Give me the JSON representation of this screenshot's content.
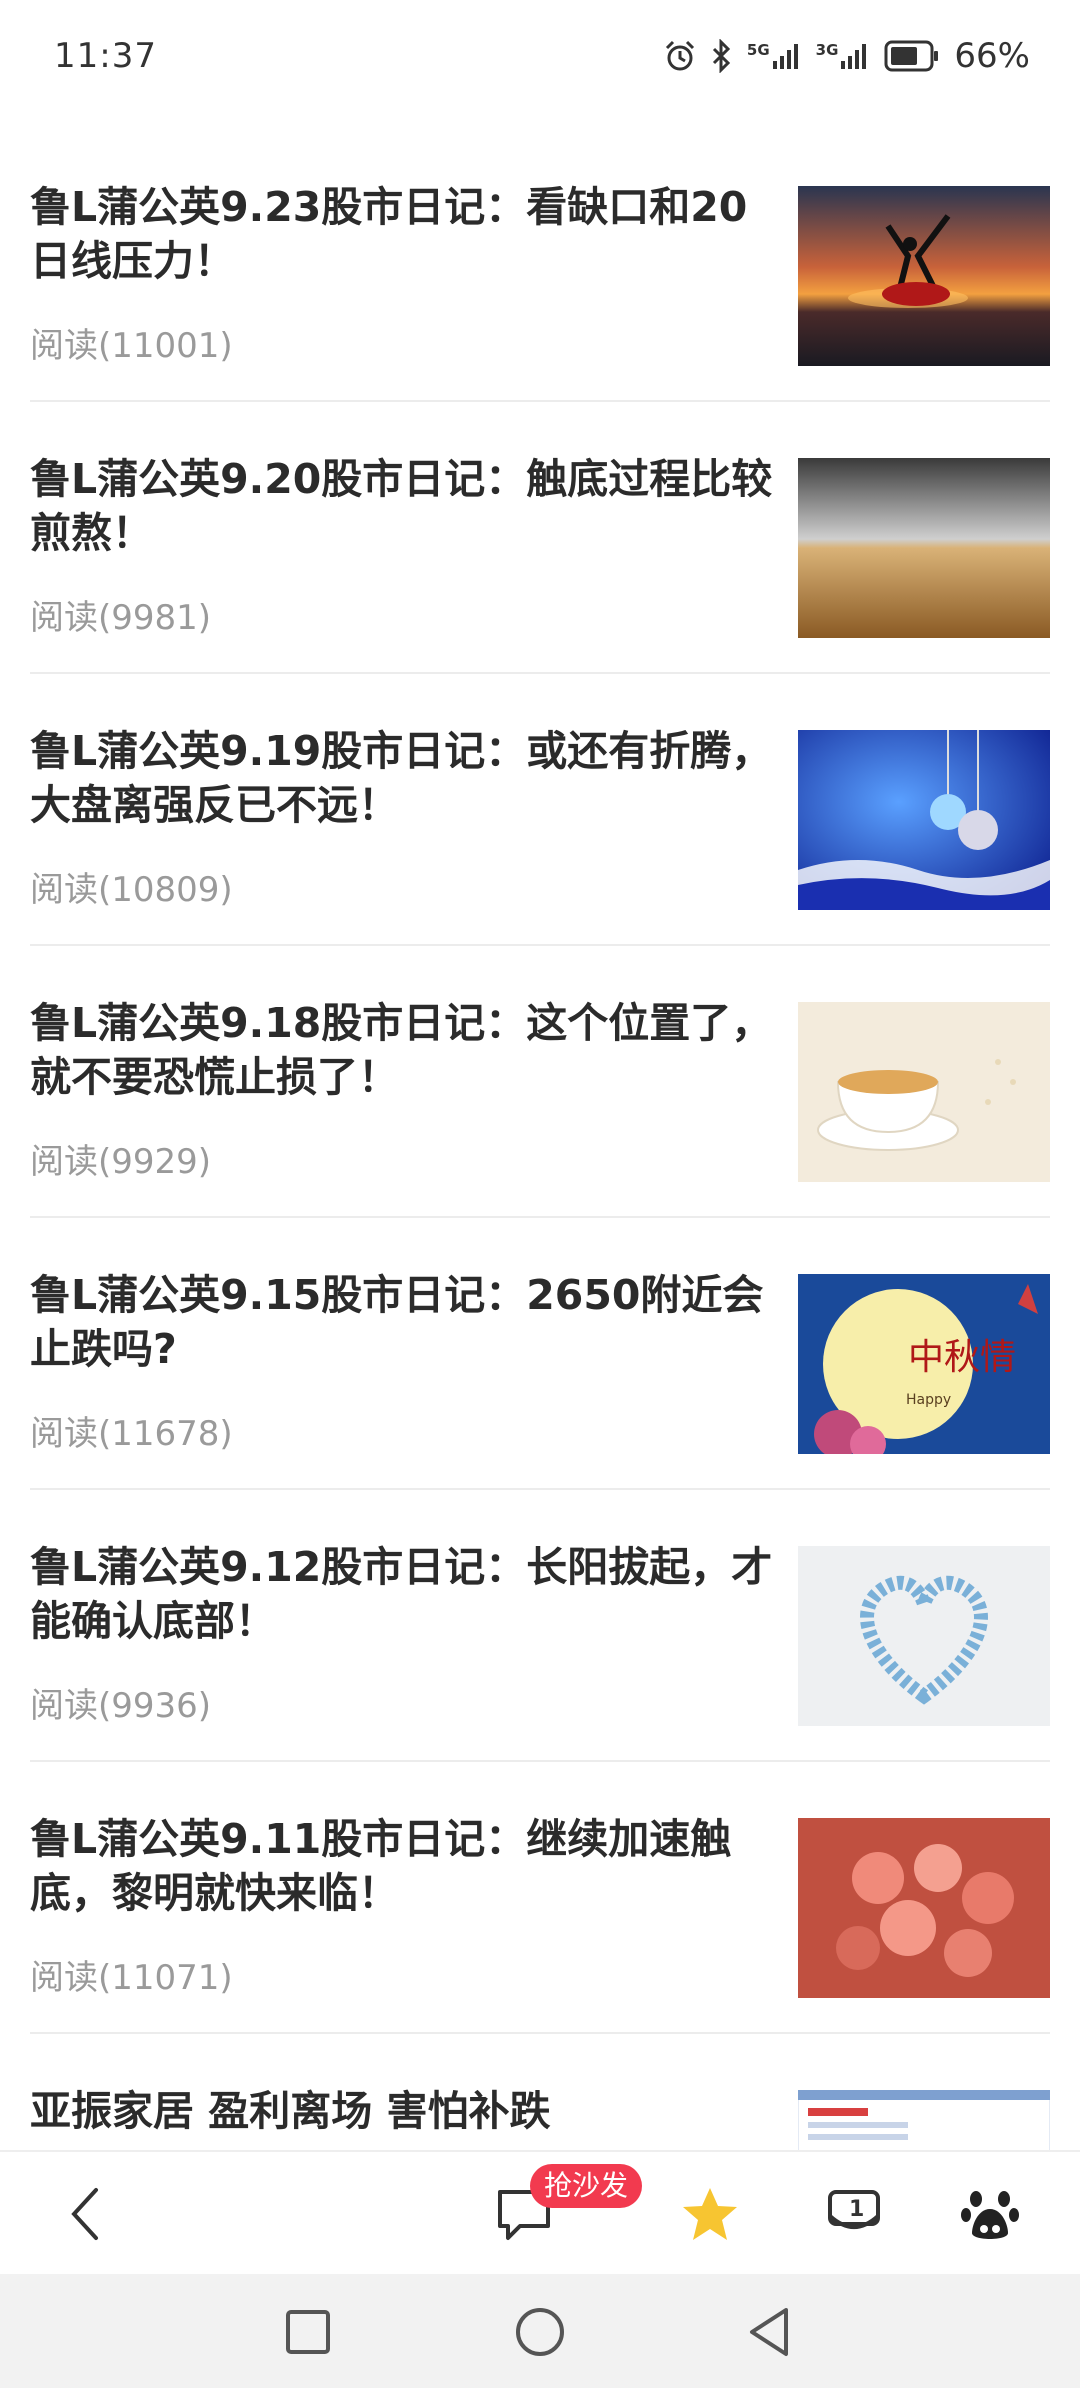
{
  "status_bar": {
    "time": "11:37",
    "network1": "5G",
    "network2": "3G",
    "battery": "66%"
  },
  "articles": [
    {
      "title": "鲁L蒲公英9.23股市日记：看缺口和20日线压力！",
      "reads": "阅读(11001)",
      "thumb": "dancer-sunset-image"
    },
    {
      "title": "鲁L蒲公英9.20股市日记：触底过程比较煎熬！",
      "reads": "阅读(9981)",
      "thumb": "wheat-field-image"
    },
    {
      "title": "鲁L蒲公英9.19股市日记：或还有折腾，大盘离强反已不远！",
      "reads": "阅读(10809)",
      "thumb": "christmas-ornaments-image"
    },
    {
      "title": "鲁L蒲公英9.18股市日记：这个位置了，就不要恐慌止损了！",
      "reads": "阅读(9929)",
      "thumb": "tea-cup-image"
    },
    {
      "title": "鲁L蒲公英9.15股市日记：2650附近会止跌吗?",
      "reads": "阅读(11678)",
      "thumb": "mid-autumn-moon-image"
    },
    {
      "title": "鲁L蒲公英9.12股市日记：长阳拔起，才能确认底部！",
      "reads": "阅读(9936)",
      "thumb": "blue-heart-image"
    },
    {
      "title": "鲁L蒲公英9.11股市日记：继续加速触底，黎明就快来临！",
      "reads": "阅读(11071)",
      "thumb": "roses-image"
    },
    {
      "title": "亚振家居 盈利离场 害怕补跌",
      "reads": "",
      "thumb": "table-screenshot-image"
    }
  ],
  "thumb_text": {
    "moon_big": "中秋情",
    "moon_small": "Happy"
  },
  "toolbar": {
    "sofa_badge": "抢沙发",
    "tabs_count": "1",
    "favorite_color": "#f7c531",
    "badge_color": "#f23a4f"
  }
}
